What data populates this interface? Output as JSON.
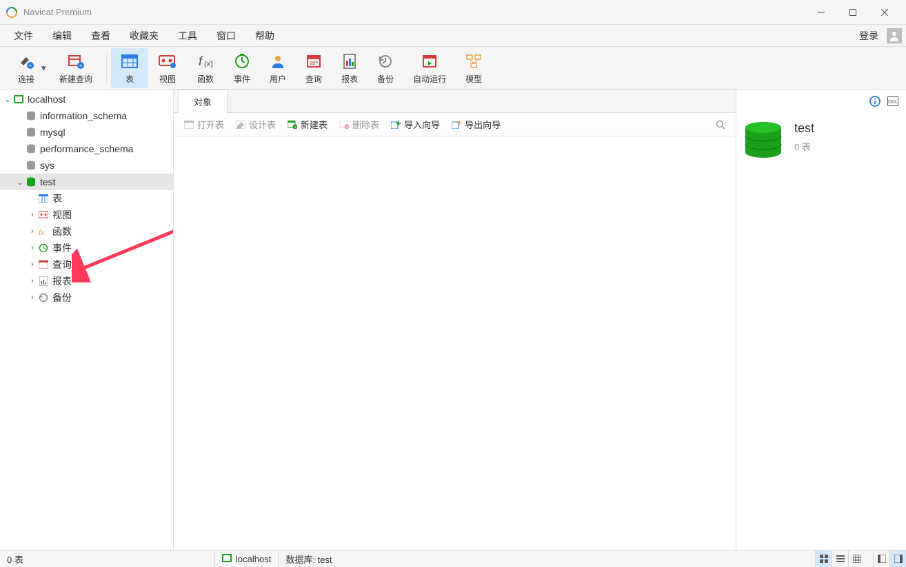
{
  "window": {
    "title": "Navicat Premium"
  },
  "menu": {
    "items": [
      "文件",
      "编辑",
      "查看",
      "收藏夹",
      "工具",
      "窗口",
      "帮助"
    ],
    "login": "登录"
  },
  "toolbar": {
    "connect": "连接",
    "new_query": "新建查询",
    "table": "表",
    "view": "视图",
    "function": "函数",
    "event": "事件",
    "user": "用户",
    "query": "查询",
    "report": "报表",
    "backup": "备份",
    "auto_run": "自动运行",
    "model": "模型"
  },
  "tree": {
    "connection": "localhost",
    "dbs": [
      "information_schema",
      "mysql",
      "performance_schema",
      "sys"
    ],
    "selected_db": "test",
    "children": {
      "table": "表",
      "view": "视图",
      "function": "函数",
      "event": "事件",
      "query": "查询",
      "report": "报表",
      "backup": "备份"
    }
  },
  "tabs": {
    "objects": "对象"
  },
  "subtoolbar": {
    "open_table": "打开表",
    "design_table": "设计表",
    "new_table": "新建表",
    "delete_table": "删除表",
    "import_wizard": "导入向导",
    "export_wizard": "导出向导"
  },
  "rightpanel": {
    "title": "test",
    "subtitle": "0 表"
  },
  "statusbar": {
    "left": "0 表",
    "connection": "localhost",
    "db_label": "数据库: test"
  }
}
